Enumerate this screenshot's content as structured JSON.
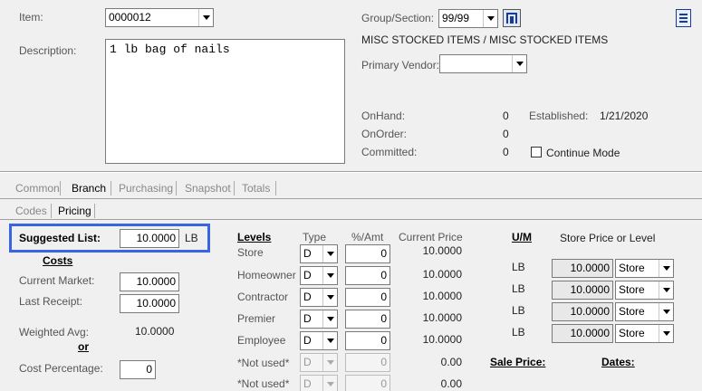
{
  "header": {
    "item_label": "Item:",
    "item_value": "0000012",
    "description_label": "Description:",
    "description_value": "1 lb bag of nails",
    "group_label": "Group/Section:",
    "group_value": "99/99",
    "group_text": "MISC STOCKED ITEMS / MISC STOCKED ITEMS",
    "vendor_label": "Primary Vendor:",
    "vendor_value": "",
    "onhand_label": "OnHand:",
    "onhand_value": "0",
    "onorder_label": "OnOrder:",
    "onorder_value": "0",
    "committed_label": "Committed:",
    "committed_value": "0",
    "established_label": "Established:",
    "established_value": "1/21/2020",
    "continue_mode_label": "Continue Mode",
    "continue_mode_checked": false
  },
  "main_tabs": [
    {
      "label": "Common",
      "key": "o"
    },
    {
      "label": "Branch",
      "key": "B"
    },
    {
      "label": "Purchasing",
      "key": "P"
    },
    {
      "label": "Snapshot",
      "key": "S"
    },
    {
      "label": "Totals",
      "key": "T"
    }
  ],
  "active_main_tab": "Branch",
  "sub_tabs": [
    {
      "label": "Codes"
    },
    {
      "label": "Pricing"
    }
  ],
  "active_sub_tab": "Pricing",
  "pricing": {
    "suggested_list_label": "Suggested List:",
    "suggested_list_value": "10.0000",
    "suggested_list_unit": "LB",
    "costs_label": "Costs",
    "current_market_label": "Current Market:",
    "current_market_value": "10.0000",
    "last_receipt_label": "Last Receipt:",
    "last_receipt_value": "10.0000",
    "weighted_avg_label": "Weighted Avg:",
    "weighted_avg_value": "10.0000",
    "or_label": "or",
    "cost_percentage_label": "Cost Percentage:",
    "cost_percentage_value": "0",
    "levels_header": "Levels",
    "type_header": "Type",
    "pct_amt_header": "%/Amt",
    "current_price_header": "Current Price",
    "levels": [
      {
        "name": "Store",
        "type": "D",
        "amt": "0",
        "price": "10.0000"
      },
      {
        "name": "Homeowner",
        "type": "D",
        "amt": "0",
        "price": "10.0000"
      },
      {
        "name": "Contractor",
        "type": "D",
        "amt": "0",
        "price": "10.0000"
      },
      {
        "name": "Premier",
        "type": "D",
        "amt": "0",
        "price": "10.0000"
      },
      {
        "name": "Employee",
        "type": "D",
        "amt": "0",
        "price": "10.0000"
      },
      {
        "name": "*Not used*",
        "type": "D",
        "amt": "0",
        "price": "0.00"
      },
      {
        "name": "*Not used*",
        "type": "D",
        "amt": "0",
        "price": "0.00"
      }
    ],
    "um_header": "U/M",
    "store_price_header": "Store Price or Level",
    "um_rows": [
      {
        "unit": "LB",
        "price": "10.0000",
        "level": "Store"
      },
      {
        "unit": "LB",
        "price": "10.0000",
        "level": "Store"
      },
      {
        "unit": "LB",
        "price": "10.0000",
        "level": "Store"
      },
      {
        "unit": "LB",
        "price": "10.0000",
        "level": "Store"
      }
    ],
    "sale_price_label": "Sale Price:",
    "dates_label": "Dates:"
  },
  "colors": {
    "highlight_border": "#3a64e6",
    "window_bg": "#f0f0f0",
    "menu_icon": "#1a3a9a"
  }
}
